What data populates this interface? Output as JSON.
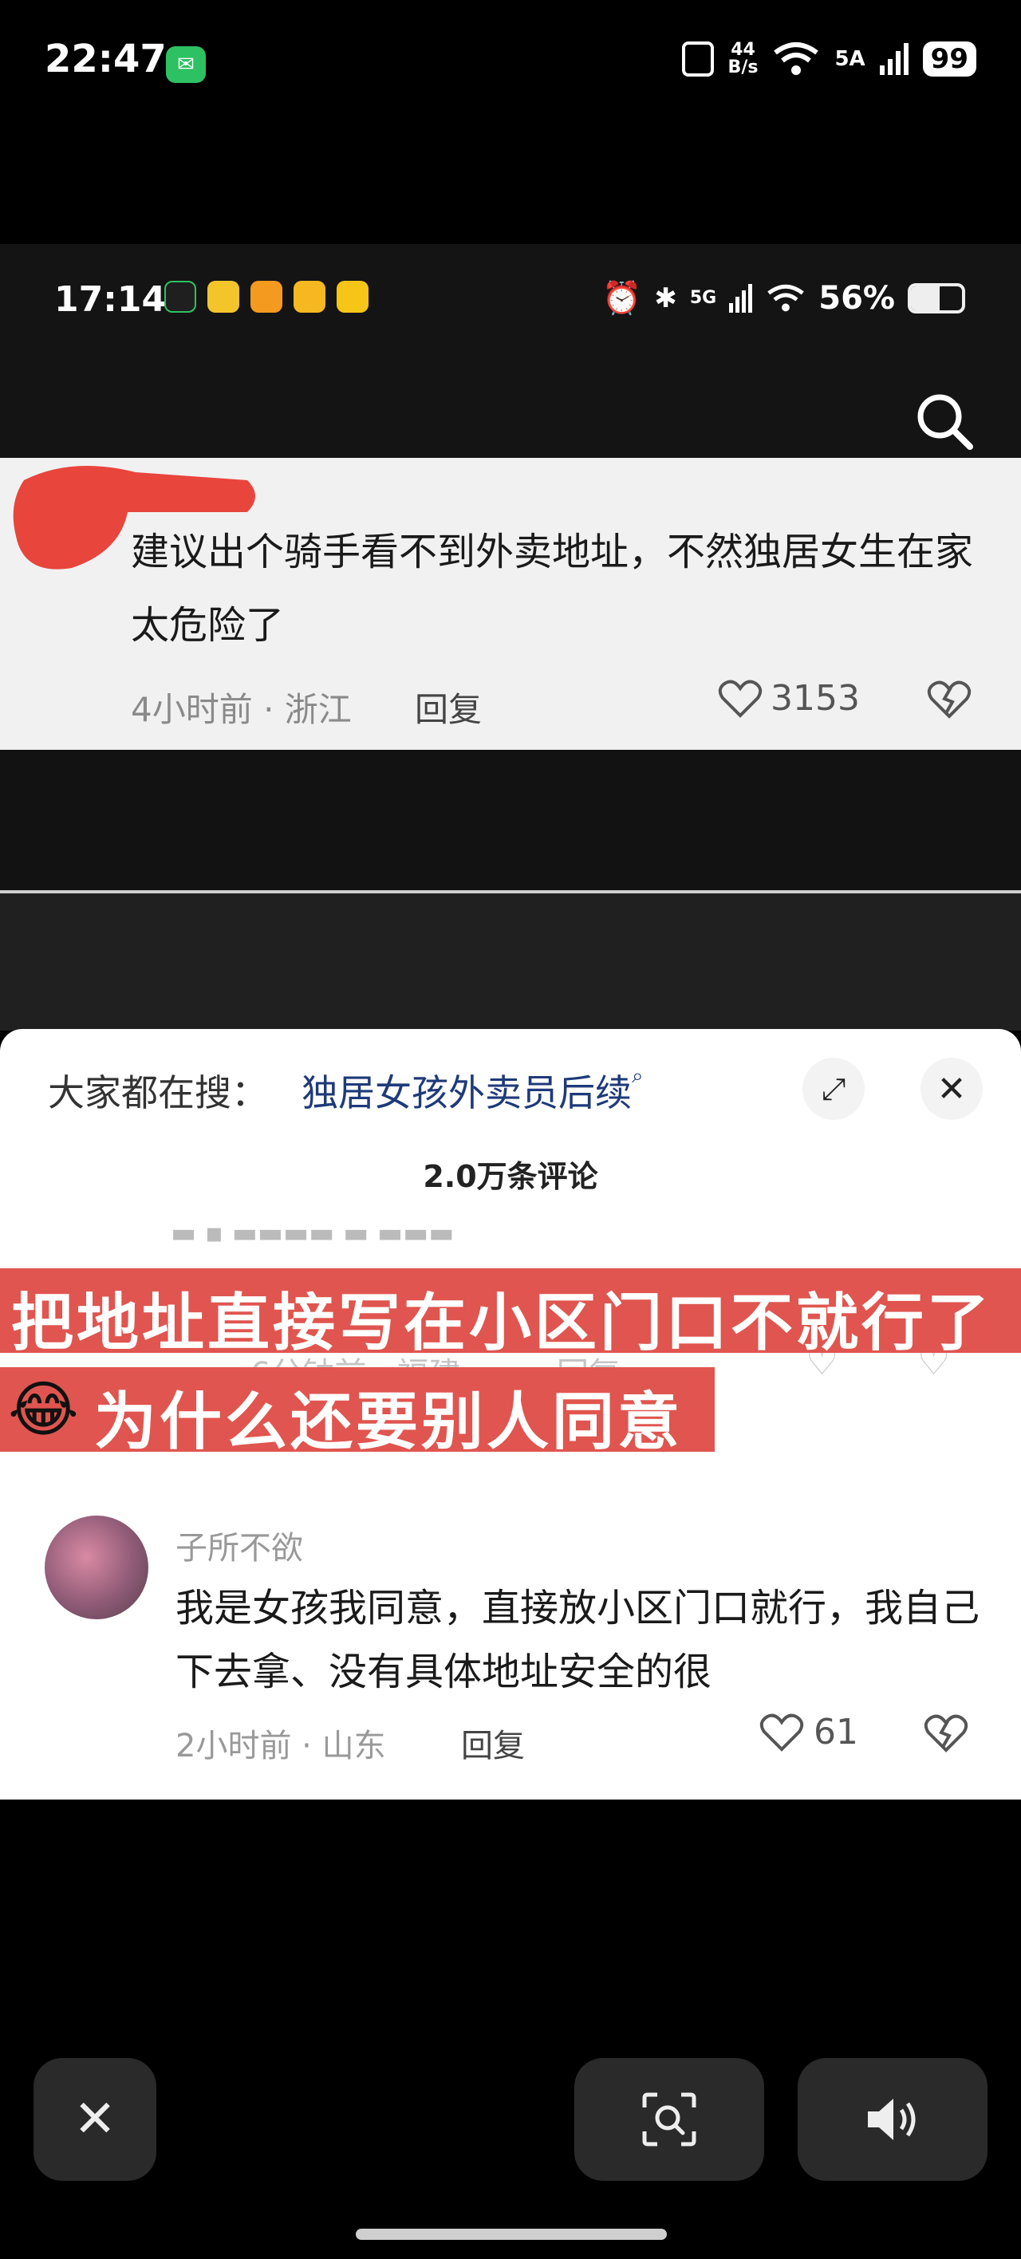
{
  "outer_status": {
    "time": "22:47",
    "net_speed_top": "44",
    "net_speed_bottom": "B/s",
    "signal_label": "5A",
    "battery": "99"
  },
  "inner_status": {
    "time": "17:14",
    "network": "5G",
    "battery": "56%",
    "battery_level": 0.56
  },
  "comment1": {
    "text": "建议出个骑手看不到外卖地址，不然独居女生在家太危险了",
    "meta": "4小时前 · 浙江",
    "reply": "回复",
    "likes": "3153"
  },
  "sheet": {
    "search_label": "大家都在搜：",
    "search_term": "独居女孩外卖员后续",
    "count": "2.0万条评论"
  },
  "ghost_comment": {
    "meta": "6分钟前 · 福建",
    "reply": "回复"
  },
  "caption": {
    "line1": "把地址直接写在小区门口不就行了",
    "emoji": "😂",
    "line2": "为什么还要别人同意"
  },
  "comment2": {
    "username": "子所不欲",
    "text": "我是女孩我同意，直接放小区门口就行，我自己下去拿、没有具体地址安全的很",
    "meta": "2小时前 · 山东",
    "reply": "回复",
    "likes": "61"
  },
  "colors": {
    "caption_bg": "#e0554f",
    "wechat_green": "#2dc163",
    "search_term": "#1f3a7a"
  }
}
